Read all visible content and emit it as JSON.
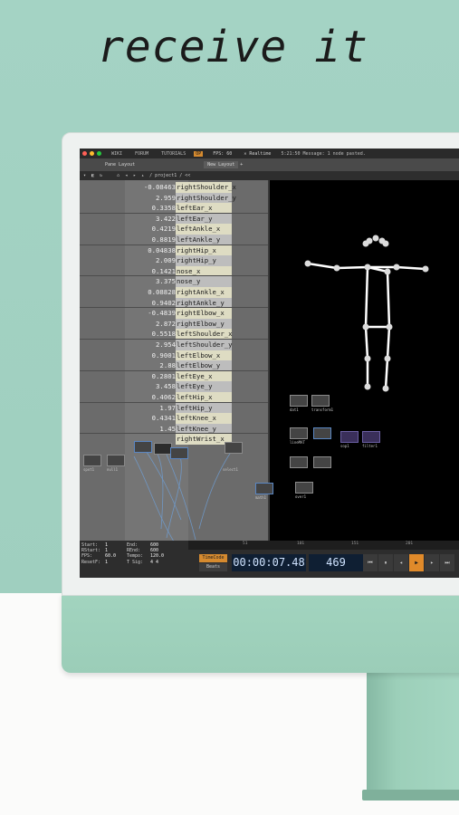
{
  "headline": "receive it",
  "menu": {
    "items": [
      "WIKI",
      "FORUM",
      "TUTORIALS"
    ],
    "badge": "OP",
    "fps_label": "FPS: 60",
    "realtime": "Realtime",
    "message": "5:21:50 Message: 1 node pasted."
  },
  "tabs": {
    "pane": "Pane Layout",
    "new": "New Layout",
    "add": "+"
  },
  "path": "/ project1 / <<",
  "table_rows": [
    {
      "value": "-0.08463",
      "label": "rightShoulder_x"
    },
    {
      "value": "2.959",
      "label": "rightShoulder_y"
    },
    {
      "value": "0.3358",
      "label": "leftEar_x"
    },
    {
      "value": "3.422",
      "label": "leftEar_y"
    },
    {
      "value": "0.4219",
      "label": "leftAnkle_x"
    },
    {
      "value": "0.8819",
      "label": "leftAnkle_y"
    },
    {
      "value": "0.04838",
      "label": "rightHip_x"
    },
    {
      "value": "2.009",
      "label": "rightHip_y"
    },
    {
      "value": "0.1421",
      "label": "nose_x"
    },
    {
      "value": "3.375",
      "label": "nose_y"
    },
    {
      "value": "0.08828",
      "label": "rightAnkle_x"
    },
    {
      "value": "0.9402",
      "label": "rightAnkle_y"
    },
    {
      "value": "-0.4839",
      "label": "rightElbow_x"
    },
    {
      "value": "2.872",
      "label": "rightElbow_y"
    },
    {
      "value": "0.5518",
      "label": "leftShoulder_x"
    },
    {
      "value": "2.954",
      "label": "leftShoulder_y"
    },
    {
      "value": "0.9001",
      "label": "leftElbow_x"
    },
    {
      "value": "2.88",
      "label": "leftElbow_y"
    },
    {
      "value": "0.2801",
      "label": "leftEye_x"
    },
    {
      "value": "3.458",
      "label": "leftEye_y"
    },
    {
      "value": "0.4062",
      "label": "leftHip_x"
    },
    {
      "value": "1.97",
      "label": "leftHip_y"
    },
    {
      "value": "0.4341",
      "label": "leftKnee_x"
    },
    {
      "value": "1.45",
      "label": "leftKnee_y"
    },
    {
      "value": "",
      "label": "rightWrist_x"
    }
  ],
  "ruler_ticks": [
    "51",
    "101",
    "151",
    "201"
  ],
  "stats": [
    {
      "k": "Start:",
      "v": "1",
      "k2": "End:",
      "v2": "600"
    },
    {
      "k": "RStart:",
      "v": "1",
      "k2": "REnd:",
      "v2": "600"
    },
    {
      "k": "FPS:",
      "v": "60.0",
      "k2": "Tempo:",
      "v2": "120.0"
    },
    {
      "k": "ResetF:",
      "v": "1",
      "k2": "T Sig:",
      "v2": "4    4"
    }
  ],
  "timecode_label": "TimeCode",
  "beats_label": "Beats",
  "timecode": "00:00:07.48",
  "frame": "469",
  "transport": [
    "⏮",
    "⏸",
    "◂",
    "▶",
    "▸",
    "⏭"
  ],
  "nodes": [
    {
      "label": "spot1"
    },
    {
      "label": "null1"
    },
    {
      "label": "select1"
    },
    {
      "label": "math1"
    },
    {
      "label": "over1"
    },
    {
      "label": "dat1"
    },
    {
      "label": "transform1"
    },
    {
      "label": "lineMAT"
    },
    {
      "label": "sop1"
    },
    {
      "label": "filter1"
    }
  ]
}
